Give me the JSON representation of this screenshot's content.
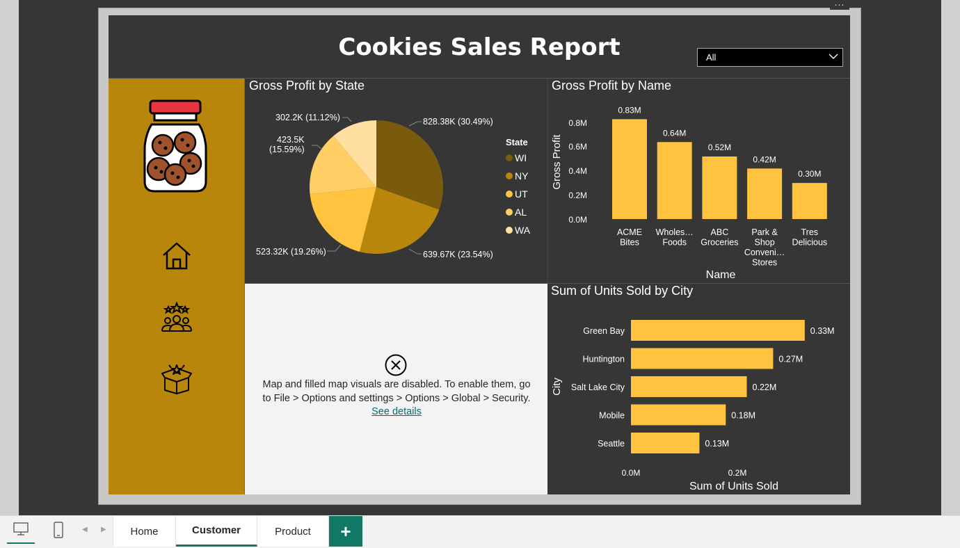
{
  "report": {
    "title": "Cookies Sales Report",
    "slicer_value": "All",
    "more_label": "..."
  },
  "sidebar": {
    "logo": "cookie-jar-icon",
    "nav": [
      {
        "name": "home",
        "icon": "home-icon"
      },
      {
        "name": "customer",
        "icon": "customers-icon"
      },
      {
        "name": "product",
        "icon": "product-box-icon"
      }
    ]
  },
  "pie": {
    "title": "Gross Profit by State",
    "legend_title": "State",
    "labels": [
      "828.38K (30.49%)",
      "639.67K (23.54%)",
      "523.32K (19.26%)",
      "423.5K",
      "(15.59%)",
      "302.2K (11.12%)"
    ]
  },
  "bar": {
    "title": "Gross Profit by Name",
    "xlabel": "Name",
    "ylabel": "Gross Profit",
    "yticks": [
      "0.8M",
      "0.6M",
      "0.4M",
      "0.2M",
      "0.0M"
    ],
    "data_labels": [
      "0.83M",
      "0.64M",
      "0.52M",
      "0.42M",
      "0.30M"
    ],
    "category_lines": [
      [
        "ACME",
        "Bites"
      ],
      [
        "Wholes…",
        "Foods"
      ],
      [
        "ABC",
        "Groceries"
      ],
      [
        "Park &",
        "Shop",
        "Conveni…",
        "Stores"
      ],
      [
        "Tres",
        "Delicious"
      ]
    ]
  },
  "hbar": {
    "title": "Sum of Units Sold by City",
    "xlabel": "Sum of Units Sold",
    "ylabel": "City",
    "xticks": [
      "0.0M",
      "0.2M"
    ],
    "data_labels": [
      "0.33M",
      "0.27M",
      "0.22M",
      "0.18M",
      "0.13M"
    ]
  },
  "map": {
    "message": "Map and filled map visuals are disabled. To enable them, go to File > Options and settings > Options > Global > Security.",
    "link": "See details"
  },
  "pages": {
    "tabs": [
      "Home",
      "Customer",
      "Product"
    ],
    "active": "Customer",
    "add_label": "+"
  },
  "colors": {
    "gold": "#b8860b",
    "bar": "#ffc340",
    "pie": [
      "#7a5a0c",
      "#b8860b",
      "#ffc340",
      "#ffcf66",
      "#ffe0a0"
    ],
    "accent": "#117865",
    "dark": "#363636"
  },
  "chart_data": [
    {
      "type": "pie",
      "title": "Gross Profit by State",
      "legend_title": "State",
      "categories": [
        "WI",
        "NY",
        "UT",
        "AL",
        "WA"
      ],
      "values": [
        828380,
        639670,
        523320,
        423500,
        302200
      ],
      "percents": [
        30.49,
        23.54,
        19.26,
        15.59,
        11.12
      ],
      "legend": "right"
    },
    {
      "type": "bar",
      "title": "Gross Profit by Name",
      "categories": [
        "ACME Bites",
        "Wholes… Foods",
        "ABC Groceries",
        "Park & Shop Conveni… Stores",
        "Tres Delicious"
      ],
      "values": [
        0.83,
        0.64,
        0.52,
        0.42,
        0.3
      ],
      "unit": "M",
      "xlabel": "Name",
      "ylabel": "Gross Profit",
      "ylim": [
        0,
        0.8
      ]
    },
    {
      "type": "bar",
      "orientation": "horizontal",
      "title": "Sum of Units Sold by City",
      "categories": [
        "Green Bay",
        "Huntington",
        "Salt Lake City",
        "Mobile",
        "Seattle"
      ],
      "values": [
        0.33,
        0.27,
        0.22,
        0.18,
        0.13
      ],
      "unit": "M",
      "xlabel": "Sum of Units Sold",
      "ylabel": "City",
      "xlim": [
        0,
        0.2
      ]
    }
  ]
}
